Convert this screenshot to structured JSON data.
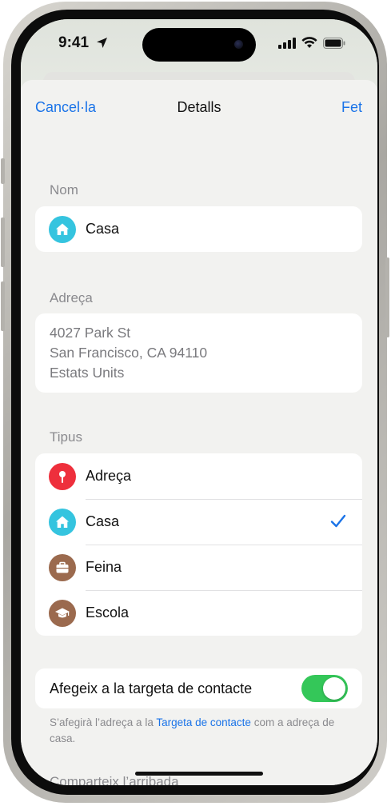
{
  "status_bar": {
    "time": "9:41"
  },
  "nav": {
    "cancel_label": "Cancel·la",
    "title": "Detalls",
    "done_label": "Fet"
  },
  "name_section": {
    "label": "Nom",
    "value": "Casa"
  },
  "address_section": {
    "label": "Adreça",
    "lines": [
      "4027 Park St",
      "San Francisco, CA  94110",
      "Estats Units"
    ]
  },
  "type_section": {
    "label": "Tipus",
    "options": [
      {
        "label": "Adreça",
        "icon": "pin-icon",
        "color": "#ee2f3c"
      },
      {
        "label": "Casa",
        "icon": "house-icon",
        "color": "#35c4df",
        "selected": true
      },
      {
        "label": "Feina",
        "icon": "briefcase-icon",
        "color": "#9b6a4e"
      },
      {
        "label": "Escola",
        "icon": "graduation-cap-icon",
        "color": "#9b6a4e"
      }
    ]
  },
  "contact_toggle": {
    "label": "Afegeix a la targeta de contacte",
    "on": true,
    "footnote_before": "S’afegirà l’adreça a la ",
    "footnote_link": "Targeta de contacte",
    "footnote_after": " com a adreça de casa."
  },
  "share_section": {
    "label": "Comparteix l’arribada"
  },
  "colors": {
    "accent": "#1a73e8",
    "toggle_on": "#34c759"
  }
}
